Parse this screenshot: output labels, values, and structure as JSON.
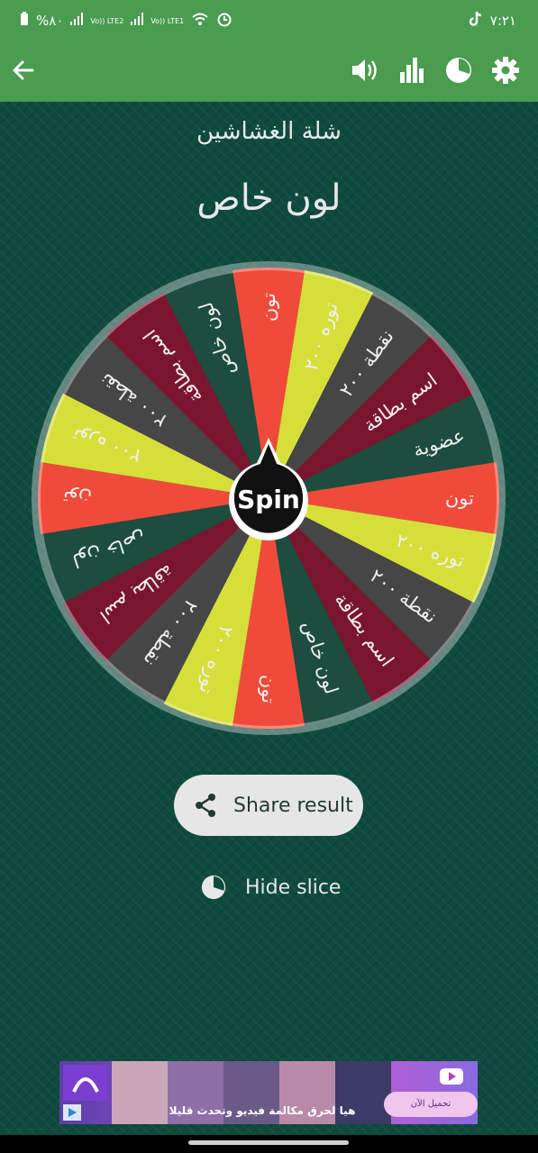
{
  "status_bar": {
    "battery": "%٨٠",
    "net1": "Vo)) LTE2",
    "net2": "Vo)) LTE1",
    "time": "٧:٢١"
  },
  "app_bar": {
    "icons": [
      "back-arrow-icon",
      "volume-icon",
      "bar-chart-icon",
      "pie-chart-icon",
      "gear-icon"
    ]
  },
  "wheel": {
    "subtitle": "شلة الغشاشين",
    "result": "لون خاص",
    "spin_label": "Spin",
    "slices": [
      {
        "label": "تون",
        "color": "#f04b3a"
      },
      {
        "label": "توره ٢٠٠",
        "color": "#d6df3a"
      },
      {
        "label": "نقطة ٢٠٠",
        "color": "#464646"
      },
      {
        "label": "اسم بطاقة",
        "color": "#7a1530"
      },
      {
        "label": "عضوية",
        "color": "#1d4d3f"
      },
      {
        "label": "تون",
        "color": "#f04b3a"
      },
      {
        "label": "توره ٢٠٠",
        "color": "#d6df3a"
      },
      {
        "label": "نقطة ٢٠٠",
        "color": "#464646"
      },
      {
        "label": "اسم بطاقة",
        "color": "#7a1530"
      },
      {
        "label": "لون خاص",
        "color": "#1d4d3f"
      },
      {
        "label": "تون",
        "color": "#f04b3a"
      },
      {
        "label": "توره ٢٠٠",
        "color": "#d6df3a"
      },
      {
        "label": "نقطة ٢٠٠",
        "color": "#464646"
      },
      {
        "label": "اسم بطاقة",
        "color": "#7a1530"
      },
      {
        "label": "لون خاص",
        "color": "#1d4d3f"
      },
      {
        "label": "تون",
        "color": "#f04b3a"
      },
      {
        "label": "توره ٢٠٠",
        "color": "#d6df3a"
      },
      {
        "label": "نقطة ٢٠٠",
        "color": "#464646"
      },
      {
        "label": "اسم بطاقة",
        "color": "#7a1530"
      },
      {
        "label": "لون خاص",
        "color": "#1d4d3f"
      }
    ]
  },
  "actions": {
    "share_label": "Share result",
    "hide_label": "Hide slice"
  },
  "ad": {
    "caption": "هيا لحرق مكالمة فيديو وتحدث قليلا",
    "cta": "تحميل الآن"
  }
}
